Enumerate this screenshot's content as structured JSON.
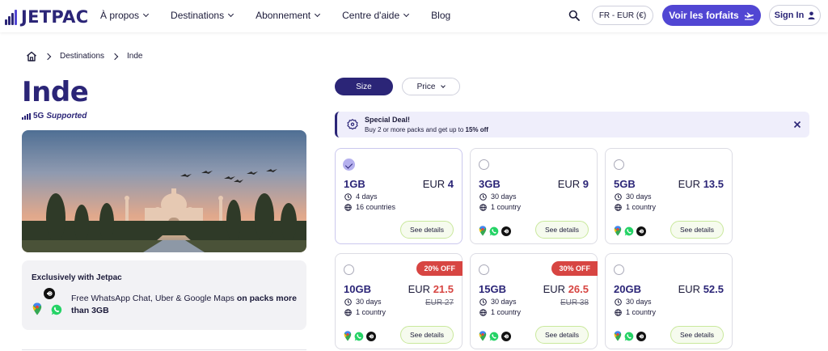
{
  "nav": {
    "logo_text": "JETPAC",
    "menu": [
      {
        "label": "À propos",
        "dropdown": true
      },
      {
        "label": "Destinations",
        "dropdown": true
      },
      {
        "label": "Abonnement",
        "dropdown": true
      },
      {
        "label": "Centre d'aide",
        "dropdown": true
      },
      {
        "label": "Blog",
        "dropdown": false
      }
    ],
    "lang_label": "FR - EUR (€)",
    "plans_label": "Voir les forfaits",
    "signin_label": "Sign In"
  },
  "breadcrumb": {
    "items": [
      "Destinations",
      "Inde"
    ]
  },
  "destination": {
    "title": "Inde",
    "network_badge": "5G",
    "network_text": "Supported"
  },
  "exclusive": {
    "title": "Exclusively with Jetpac",
    "text": "Free WhatsApp Chat, Uber & Google Maps ",
    "text_bold": "on packs more than 3GB"
  },
  "filters": {
    "size_label": "Size",
    "price_label": "Price"
  },
  "deal": {
    "title": "Special Deal!",
    "subtitle": "Buy 2 or more packs and get up to ",
    "subtitle_bold": "15% off"
  },
  "packs": [
    {
      "size": "1GB",
      "currency": "EUR",
      "price": "4",
      "days": "4 days",
      "coverage": "16 countries",
      "details": "See details",
      "selected": true,
      "apps": false
    },
    {
      "size": "3GB",
      "currency": "EUR",
      "price": "9",
      "days": "30 days",
      "coverage": "1 country",
      "details": "See details",
      "selected": false,
      "apps": true
    },
    {
      "size": "5GB",
      "currency": "EUR",
      "price": "13.5",
      "days": "30 days",
      "coverage": "1 country",
      "details": "See details",
      "selected": false,
      "apps": true
    },
    {
      "size": "10GB",
      "currency": "EUR",
      "price": "21.5",
      "old_price": "EUR 27",
      "badge": "20% OFF",
      "days": "30 days",
      "coverage": "1 country",
      "details": "See details",
      "selected": false,
      "apps": true
    },
    {
      "size": "15GB",
      "currency": "EUR",
      "price": "26.5",
      "old_price": "EUR 38",
      "badge": "30% OFF",
      "days": "30 days",
      "coverage": "1 country",
      "details": "See details",
      "selected": false,
      "apps": true
    },
    {
      "size": "20GB",
      "currency": "EUR",
      "price": "52.5",
      "days": "30 days",
      "coverage": "1 country",
      "details": "See details",
      "selected": false,
      "apps": true
    }
  ],
  "colors": {
    "brand": "#2b2577",
    "accent": "#5146d3",
    "sale": "#d74542",
    "details_border": "#c9e89c"
  },
  "icons": [
    "home-icon",
    "search-icon",
    "plane-icon",
    "user-icon",
    "signal-icon",
    "discount-icon",
    "close-icon",
    "clock-icon",
    "globe-icon",
    "google-maps-icon",
    "whatsapp-icon",
    "uber-icon"
  ]
}
